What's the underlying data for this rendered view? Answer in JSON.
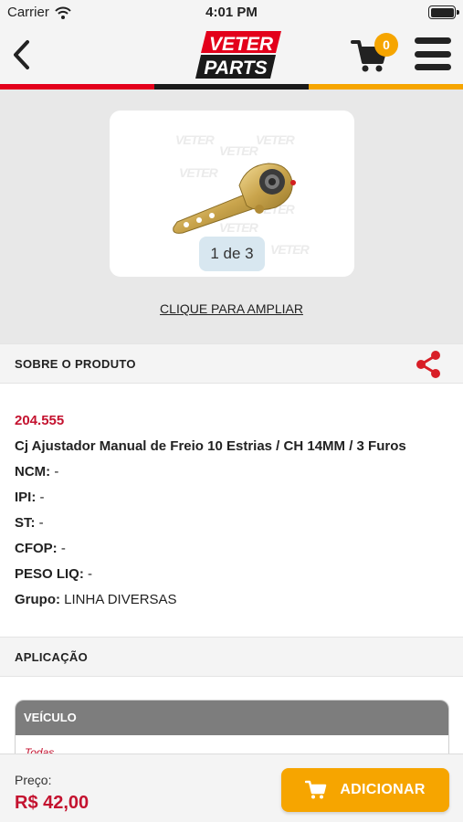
{
  "status_bar": {
    "carrier": "Carrier",
    "time": "4:01 PM"
  },
  "header": {
    "brand_top": "VETER",
    "brand_bottom": "PARTS",
    "cart_count": "0",
    "icons": [
      "back-chevron-icon",
      "cart-icon",
      "menu-icon"
    ]
  },
  "colors": {
    "brand_red": "#c4122f",
    "accent_orange": "#f6a500",
    "stripe": [
      "#e3001b",
      "#1a1a1a",
      "#f6a500"
    ]
  },
  "gallery": {
    "pager": "1 de 3",
    "zoom_link": "CLIQUE PARA AMPLIAR"
  },
  "about": {
    "title": "SOBRE O PRODUTO"
  },
  "product": {
    "code": "204.555",
    "name": "Cj Ajustador Manual de Freio 10 Estrias / CH 14MM / 3 Furos",
    "specs": [
      {
        "label": "NCM:",
        "value": "-"
      },
      {
        "label": "IPI:",
        "value": "-"
      },
      {
        "label": "ST:",
        "value": "-"
      },
      {
        "label": "CFOP:",
        "value": "-"
      },
      {
        "label": "PESO LIQ:",
        "value": "-"
      },
      {
        "label": "Grupo:",
        "value": "LINHA DIVERSAS"
      }
    ]
  },
  "application": {
    "title": "APLICAÇÃO",
    "table_header": "VEÍCULO",
    "rows": [
      "Todas"
    ]
  },
  "footer": {
    "price_label": "Preço:",
    "price": "R$ 42,00",
    "add_button": "ADICIONAR"
  }
}
